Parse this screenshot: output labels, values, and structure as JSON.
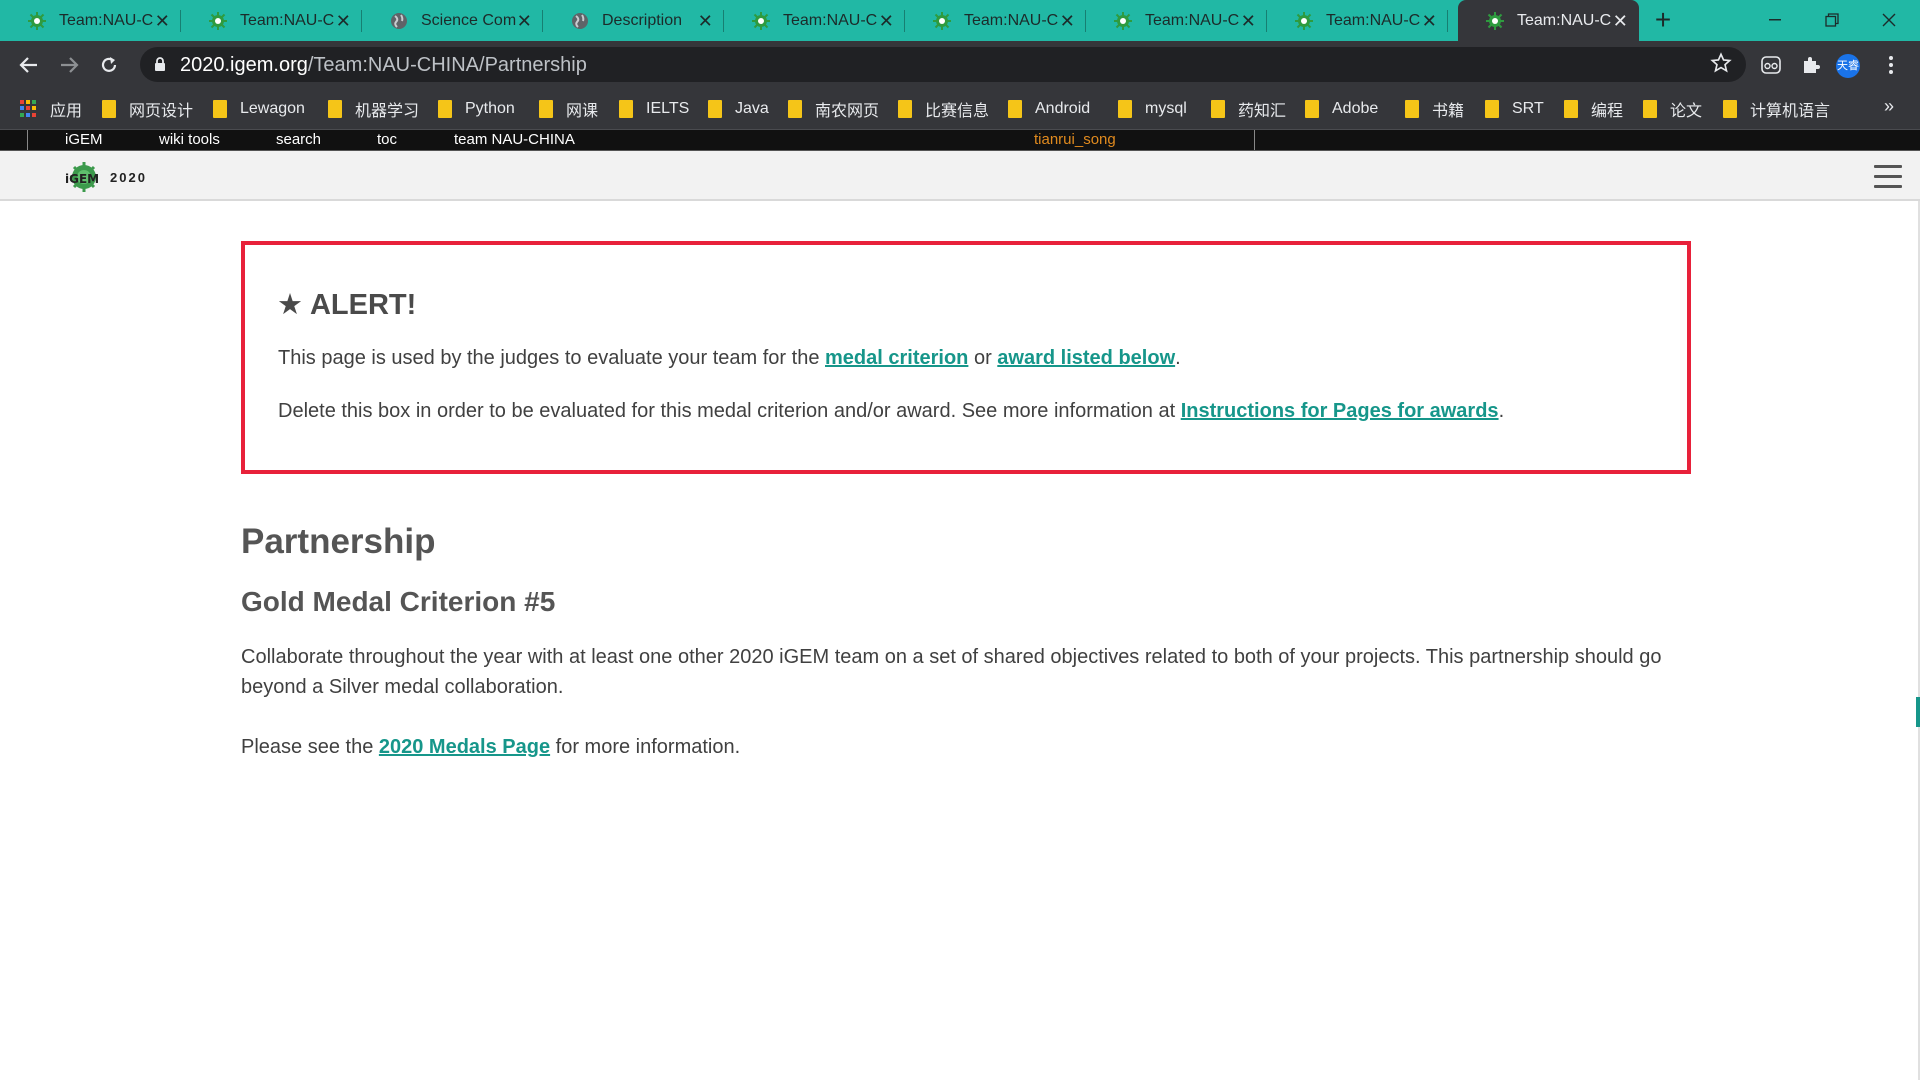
{
  "browser": {
    "tabs": [
      {
        "title": "Team:NAU-CHINA",
        "favicon": "igem-favicon",
        "active": false
      },
      {
        "title": "Team:NAU-CHINA",
        "favicon": "igem-favicon",
        "active": false
      },
      {
        "title": "Science Communication",
        "favicon": "globe-icon",
        "active": false
      },
      {
        "title": "Description",
        "favicon": "globe-icon",
        "active": false
      },
      {
        "title": "Team:NAU-CHINA",
        "favicon": "igem-favicon",
        "active": false
      },
      {
        "title": "Team:NAU-CHINA",
        "favicon": "igem-favicon",
        "active": false
      },
      {
        "title": "Team:NAU-CHINA",
        "favicon": "igem-favicon",
        "active": false
      },
      {
        "title": "Team:NAU-CHINA",
        "favicon": "igem-favicon",
        "active": false
      },
      {
        "title": "Team:NAU-CHINA",
        "favicon": "igem-favicon",
        "active": true
      }
    ],
    "new_tab": "+",
    "url_host": "2020.igem.org",
    "url_path": "/Team:NAU-CHINA/Partnership",
    "profile_label": "天睿",
    "bookmarks": [
      {
        "label": "应用",
        "icon": "apps-grid-icon"
      },
      {
        "label": "网页设计",
        "icon": "folder-icon"
      },
      {
        "label": "Lewagon",
        "icon": "folder-icon"
      },
      {
        "label": "机器学习",
        "icon": "folder-icon"
      },
      {
        "label": "Python",
        "icon": "folder-icon"
      },
      {
        "label": "网课",
        "icon": "folder-icon"
      },
      {
        "label": "IELTS",
        "icon": "folder-icon"
      },
      {
        "label": "Java",
        "icon": "folder-icon"
      },
      {
        "label": "南农网页",
        "icon": "folder-icon"
      },
      {
        "label": "比赛信息",
        "icon": "folder-icon"
      },
      {
        "label": "Android",
        "icon": "folder-icon"
      },
      {
        "label": "mysql",
        "icon": "folder-icon"
      },
      {
        "label": "药知汇",
        "icon": "folder-icon"
      },
      {
        "label": "Adobe",
        "icon": "folder-icon"
      },
      {
        "label": "书籍",
        "icon": "folder-icon"
      },
      {
        "label": "SRT",
        "icon": "folder-icon"
      },
      {
        "label": "编程",
        "icon": "folder-icon"
      },
      {
        "label": "论文",
        "icon": "folder-icon"
      },
      {
        "label": "计算机语言",
        "icon": "folder-icon"
      }
    ],
    "bookmarks_more": "»"
  },
  "igem_bar": {
    "links": [
      "iGEM",
      "wiki tools",
      "search",
      "toc",
      "team NAU-CHINA"
    ],
    "user": "tianrui_song"
  },
  "site_nav": {
    "logo_text": "2020"
  },
  "alert": {
    "title": "★ ALERT!",
    "p1_before": "This page is used by the judges to evaluate your team for the ",
    "p1_link1": "medal criterion",
    "p1_mid": " or ",
    "p1_link2": "award listed below",
    "p1_after": ".",
    "p2_before": "Delete this box in order to be evaluated for this medal criterion and/or award. See more information at ",
    "p2_link": "Instructions for Pages for awards",
    "p2_after": "."
  },
  "page": {
    "heading": "Partnership",
    "subheading": "Gold Medal Criterion #5",
    "paragraph1": "Collaborate throughout the year with at least one other 2020 iGEM team on a set of shared objectives related to both of your projects. This partnership should go beyond a Silver medal collaboration.",
    "p2_before": "Please see the ",
    "p2_link": "2020 Medals Page",
    "p2_after": " for more information."
  },
  "colors": {
    "tabstrip": "#21b8a5",
    "toolbar": "#35363a",
    "alert_border": "#e8213a",
    "link": "#16968a"
  }
}
